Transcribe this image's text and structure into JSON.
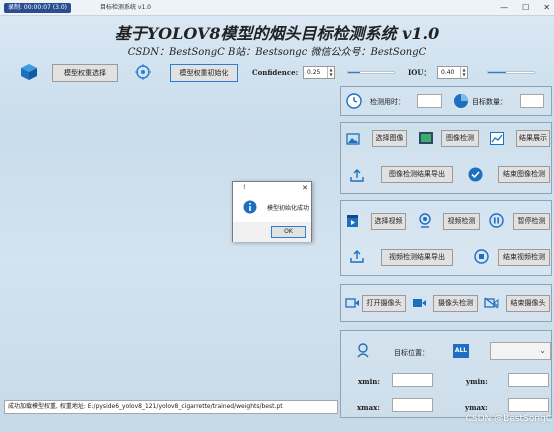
{
  "window": {
    "stamp": "录制: 00:00:07 (3.0)",
    "title": "目标检测系统 v1.0",
    "controls": [
      "—",
      "☐",
      "✕"
    ]
  },
  "header": {
    "title": "基于YOLOV8模型的烟头目标检测系统 v1.0",
    "subtitle": "CSDN：BestSongC   B站：Bestsongc   微信公众号：BestSongC"
  },
  "toolbar": {
    "model_select": "模型权重选择",
    "model_init": "模型权重初始化",
    "confidence_label": "Confidence:",
    "confidence_value": "0.25",
    "confidence_level": 0.25,
    "iou_label": "IOU：",
    "iou_value": "0.40",
    "iou_level": 0.4
  },
  "stats": {
    "time_label": "检测用时：",
    "time_value": "",
    "count_label": "目标数量：",
    "count_value": ""
  },
  "image_section": {
    "select": "选择图像",
    "detect": "图像检测",
    "show": "结果展示",
    "export": "图像检测结果导出",
    "stop": "结束图像检测"
  },
  "video_section": {
    "select": "选择视频",
    "detect": "视频检测",
    "pause": "暂停检测",
    "export": "视频检测结果导出",
    "stop": "结束视频检测"
  },
  "camera_section": {
    "open": "打开摄像头",
    "detect": "摄像头检测",
    "stop": "结束摄像头"
  },
  "target": {
    "position_label": "目标位置：",
    "all_badge": "ALL",
    "xmin": "xmin:",
    "ymin": "ymin:",
    "xmax": "xmax:",
    "ymax": "ymax:"
  },
  "status_bar": {
    "text": "成功加载模型权重, 权重地址: E:/pyside6_yolov8_121/yolov8_cigarrette/trained/weights/best.pt"
  },
  "dialog": {
    "title": "!",
    "message": "模型初始化成功",
    "ok": "OK"
  },
  "watermark": "CSDN @BestSongC",
  "colors": {
    "accent": "#1e6fbf",
    "icon": "#2a7fd4"
  }
}
